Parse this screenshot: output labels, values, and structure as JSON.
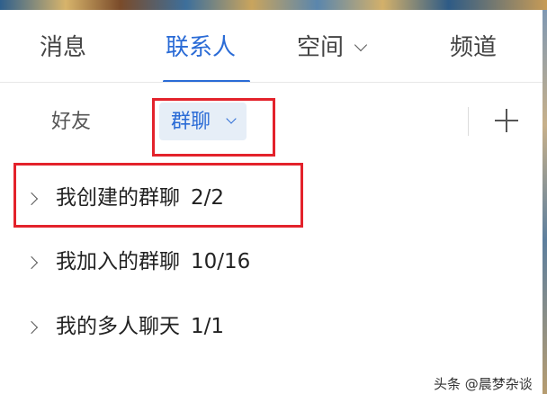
{
  "main_tabs": [
    {
      "label": "消息"
    },
    {
      "label": "联系人"
    },
    {
      "label": "空间"
    },
    {
      "label": "频道"
    }
  ],
  "sub_tabs": {
    "friends": "好友",
    "group_chat": "群聊"
  },
  "group_list": [
    {
      "label": "我创建的群聊",
      "count": "2/2"
    },
    {
      "label": "我加入的群聊",
      "count": "10/16"
    },
    {
      "label": "我的多人聊天",
      "count": "1/1"
    }
  ],
  "watermark": "头条 @晨梦杂谈",
  "colors": {
    "accent": "#2a6bd6",
    "highlight_box": "#e3222b",
    "sub_tab_active_bg": "#e6eef7"
  }
}
